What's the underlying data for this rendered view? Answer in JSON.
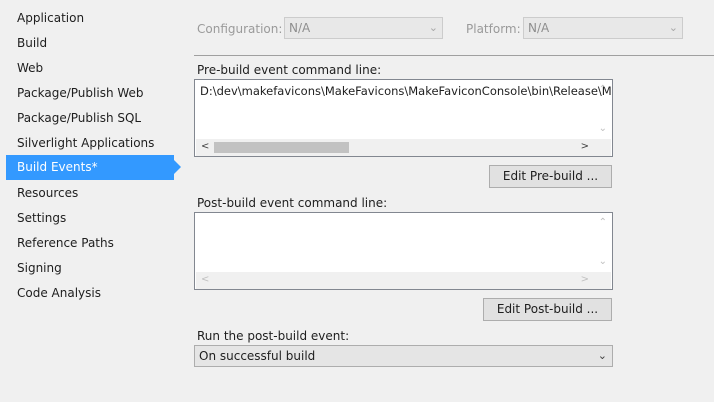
{
  "sidebar": {
    "items": [
      {
        "label": "Application"
      },
      {
        "label": "Build"
      },
      {
        "label": "Web"
      },
      {
        "label": "Package/Publish Web"
      },
      {
        "label": "Package/Publish SQL"
      },
      {
        "label": "Silverlight Applications"
      },
      {
        "label": "Build Events*"
      },
      {
        "label": "Resources"
      },
      {
        "label": "Settings"
      },
      {
        "label": "Reference Paths"
      },
      {
        "label": "Signing"
      },
      {
        "label": "Code Analysis"
      }
    ],
    "active_index": 6
  },
  "config": {
    "configuration_label": "Configuration:",
    "configuration_value": "N/A",
    "platform_label": "Platform:",
    "platform_value": "N/A"
  },
  "prebuild": {
    "label": "Pre-build event command line:",
    "value": "D:\\dev\\makefavicons\\MakeFavicons\\MakeFaviconConsole\\bin\\Release\\M",
    "edit_button": "Edit Pre-build ..."
  },
  "postbuild": {
    "label": "Post-build event command line:",
    "value": "",
    "edit_button": "Edit Post-build ..."
  },
  "run_postbuild": {
    "label": "Run the post-build event:",
    "value": "On successful build"
  },
  "icons": {
    "chevron_down": "chevron-down-icon",
    "scroll_up": "chevron-up-icon",
    "scroll_down": "chevron-down-icon",
    "scroll_left": "chevron-left-icon",
    "scroll_right": "chevron-right-icon"
  },
  "colors": {
    "accent": "#3399ff",
    "background": "#f0f0f0"
  }
}
